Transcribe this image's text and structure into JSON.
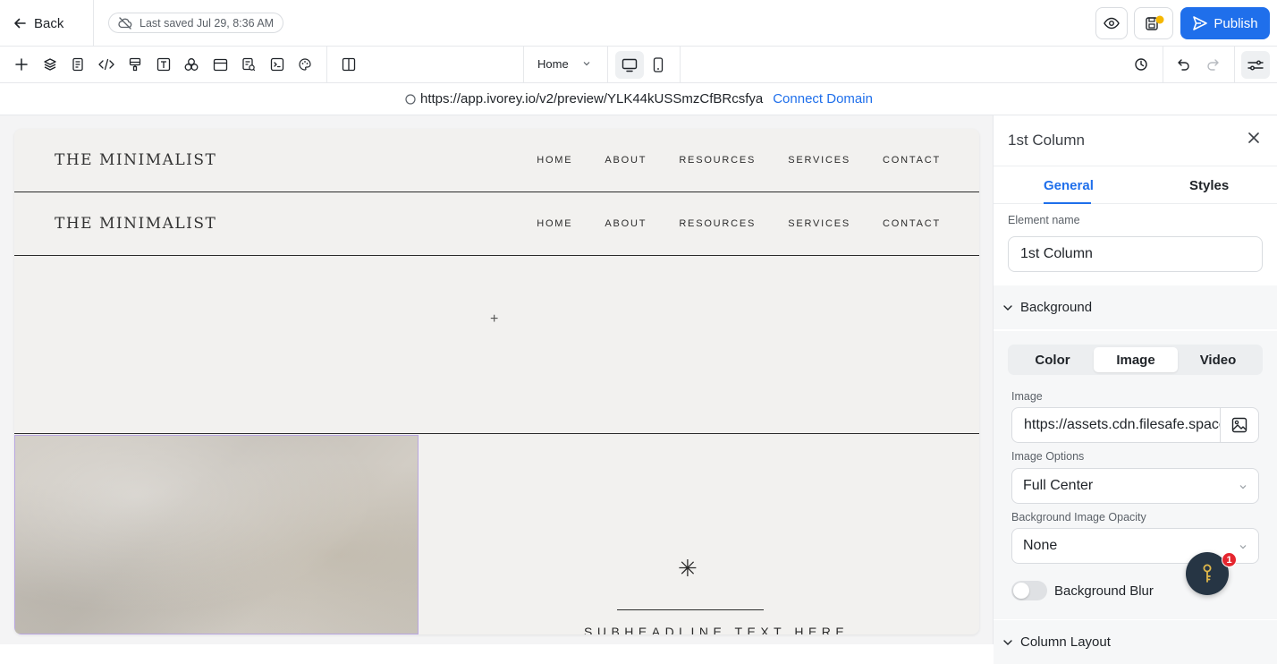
{
  "topbar": {
    "back_label": "Back",
    "saved_text": "Last saved Jul 29, 8:36 AM",
    "publish_label": "Publish",
    "accent": "#1f6feb",
    "status_dot_color": "#f5b700"
  },
  "toolbar": {
    "tools": [
      "add-icon",
      "layers-icon",
      "page-icon",
      "code-icon",
      "paint-icon",
      "text-icon",
      "shapes-icon",
      "section-icon",
      "forms-icon",
      "script-icon",
      "palette-icon",
      "columns-icon"
    ],
    "page_selector": "Home",
    "device": "desktop"
  },
  "urlbar": {
    "url": "https://app.ivorey.io/v2/preview/YLK44kUSSmzCfBRcsfya",
    "connect_label": "Connect Domain"
  },
  "canvas": {
    "logo": "THE MINIMALIST",
    "nav": [
      "HOME",
      "ABOUT",
      "RESOURCES",
      "SERVICES",
      "CONTACT"
    ],
    "add_symbol": "+",
    "asterisk": "✳",
    "subheadline": "SUBHEADLINE TEXT HERE"
  },
  "panel": {
    "title": "1st Column",
    "tabs": [
      "General",
      "Styles"
    ],
    "active_tab": "General",
    "element_name_label": "Element name",
    "element_name_value": "1st Column",
    "background_section": "Background",
    "bg_types": [
      "Color",
      "Image",
      "Video"
    ],
    "bg_type_selected": "Image",
    "image_label": "Image",
    "image_value": "https://assets.cdn.filesafe.space",
    "image_options_label": "Image Options",
    "image_options_value": "Full Center",
    "opacity_label": "Background Image Opacity",
    "opacity_value": "None",
    "blur_label": "Background Blur",
    "blur_enabled": false,
    "column_layout_section": "Column Layout"
  },
  "help": {
    "badge_count": "1"
  }
}
